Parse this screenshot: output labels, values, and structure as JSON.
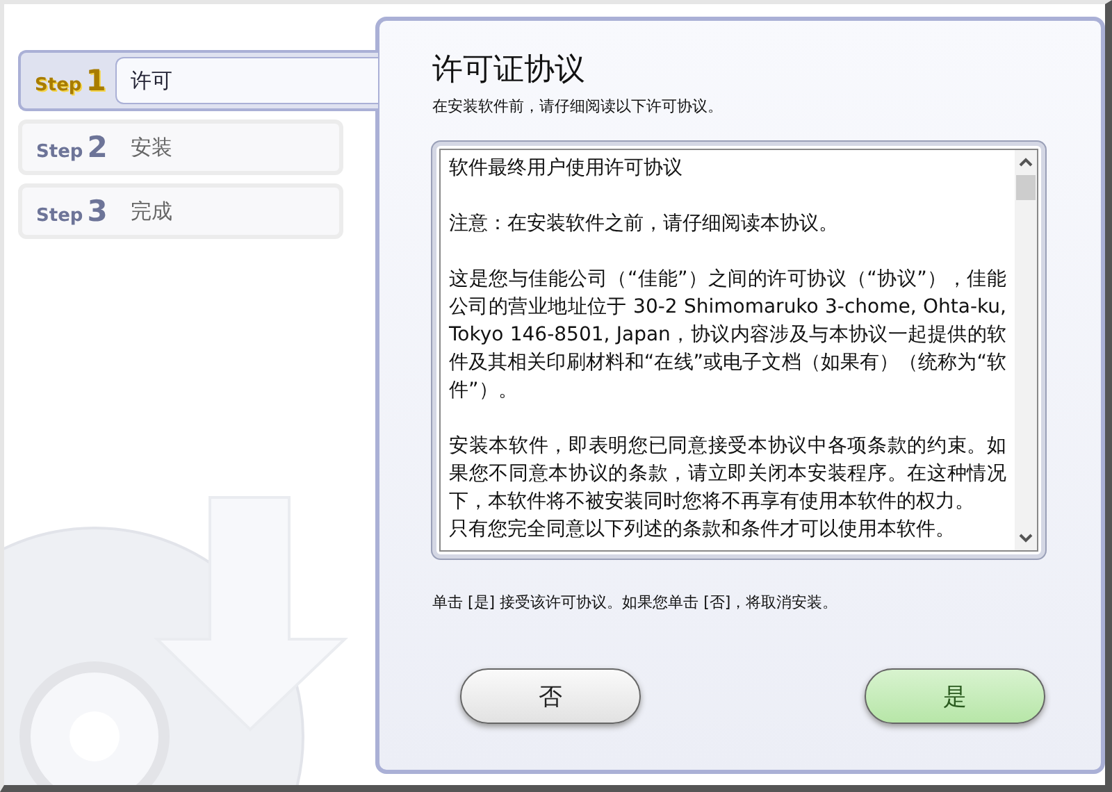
{
  "steps": [
    {
      "step_word": "Step",
      "number": "1",
      "label": "许可",
      "selected": true
    },
    {
      "step_word": "Step",
      "number": "2",
      "label": "安装",
      "selected": false
    },
    {
      "step_word": "Step",
      "number": "3",
      "label": "完成",
      "selected": false
    }
  ],
  "panel": {
    "title": "许可证协议",
    "subtitle": "在安装软件前，请仔细阅读以下许可协议。",
    "license_text": [
      [
        "软件最终用户使用许可协议"
      ],
      [
        "注意：在安装软件之前，请仔细阅读本协议。"
      ],
      [
        "这是您与佳能公司（“佳能”）之间的许可协议（“协议”），佳能公司的营业地址位于 30-2 Shimomaruko 3-chome, Ohta-ku, Tokyo 146-8501, Japan，协议内容涉及与本协议一起提供的软件及其相关印刷材料和“在线”或电子文档（如果有）（统称为“软件”）。"
      ],
      [
        "安装本软件，即表明您已同意接受本协议中各项条款的约束。如果您不同意本协议的条款，请立即关闭本安装程序。在这种情况下，本软件将不被安装同时您将不再享有使用本软件的权力。",
        "只有您完全同意以下列述的条款和条件才可以使用本软件。"
      ]
    ],
    "instruction": "单击 [是] 接受该许可协议。如果您单击 [否]，将取消安装。",
    "buttons": [
      {
        "label": "否",
        "kind": "neutral"
      },
      {
        "label": "是",
        "kind": "accept"
      }
    ]
  }
}
